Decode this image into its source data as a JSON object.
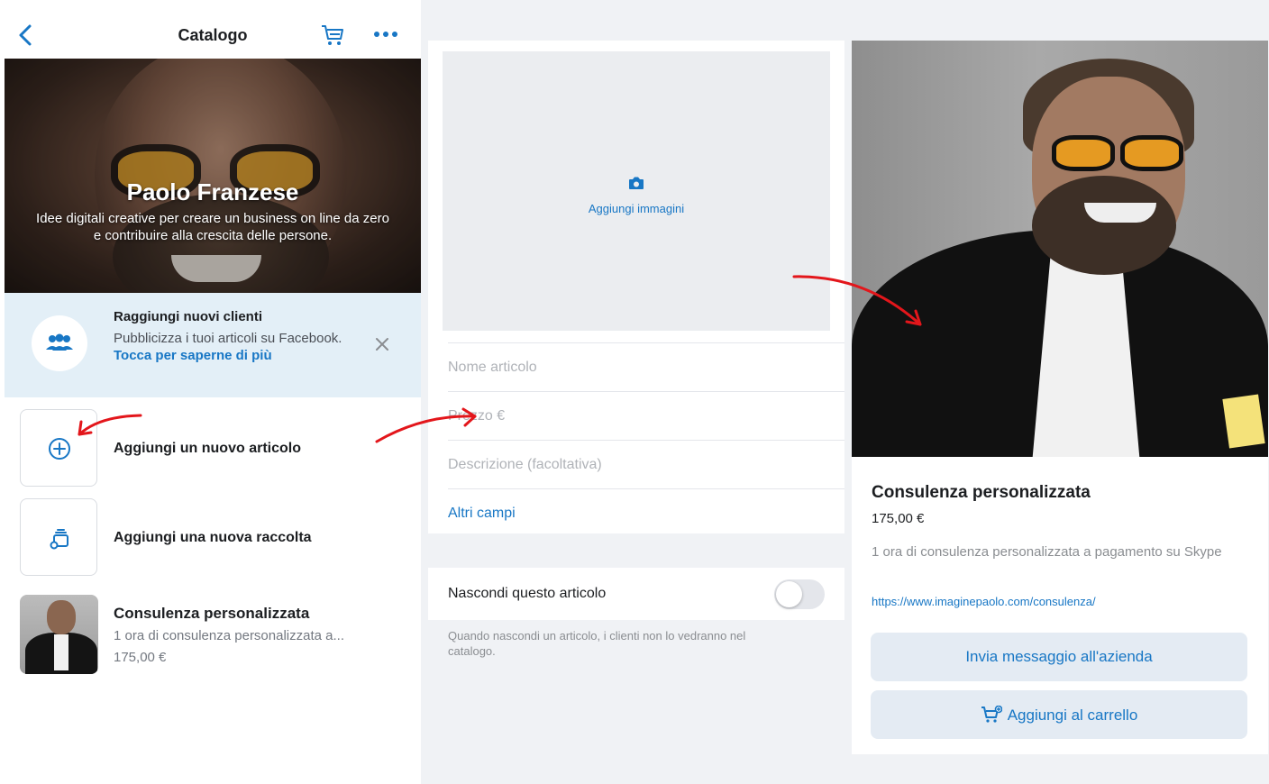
{
  "left": {
    "header": {
      "title": "Catalogo"
    },
    "hero": {
      "name": "Paolo Franzese",
      "description": "Idee digitali creative per creare un business on line da zero e contribuire alla crescita delle persone."
    },
    "promo": {
      "title": "Raggiungi nuovi clienti",
      "text": "Pubblicizza i tuoi articoli su Facebook.",
      "link": "Tocca per saperne di più"
    },
    "actions": {
      "add_item": "Aggiungi un nuovo articolo",
      "add_collection": "Aggiungi una nuova raccolta"
    },
    "item": {
      "name": "Consulenza personalizzata",
      "description": "1 ora di consulenza personalizzata a...",
      "price": "175,00 €"
    }
  },
  "middle": {
    "add_images": "Aggiungi immagini",
    "fields": {
      "name_placeholder": "Nome articolo",
      "price_placeholder": "Prezzo €",
      "description_placeholder": "Descrizione (facoltativa)",
      "more_fields": "Altri campi"
    },
    "hide": {
      "label": "Nascondi questo articolo",
      "enabled": false,
      "hint": "Quando nascondi un articolo, i clienti non lo vedranno nel catalogo."
    }
  },
  "right": {
    "product": {
      "name": "Consulenza personalizzata",
      "price": "175,00 €",
      "description": "1 ora di consulenza personalizzata a pagamento su Skype",
      "link": "https://www.imaginepaolo.com/consulenza/"
    },
    "buttons": {
      "message": "Invia messaggio all'azienda",
      "add_to_cart": "Aggiungi al carrello"
    }
  },
  "colors": {
    "accent": "#1877c5",
    "annotation_arrow": "#e3161b",
    "promo_bg": "#e3eff7",
    "panel_bg": "#f0f2f5"
  },
  "icons": [
    "back-chevron-icon",
    "cart-icon",
    "more-icon",
    "people-icon",
    "close-icon",
    "plus-circle-icon",
    "collection-icon",
    "camera-icon",
    "cart-add-icon"
  ]
}
